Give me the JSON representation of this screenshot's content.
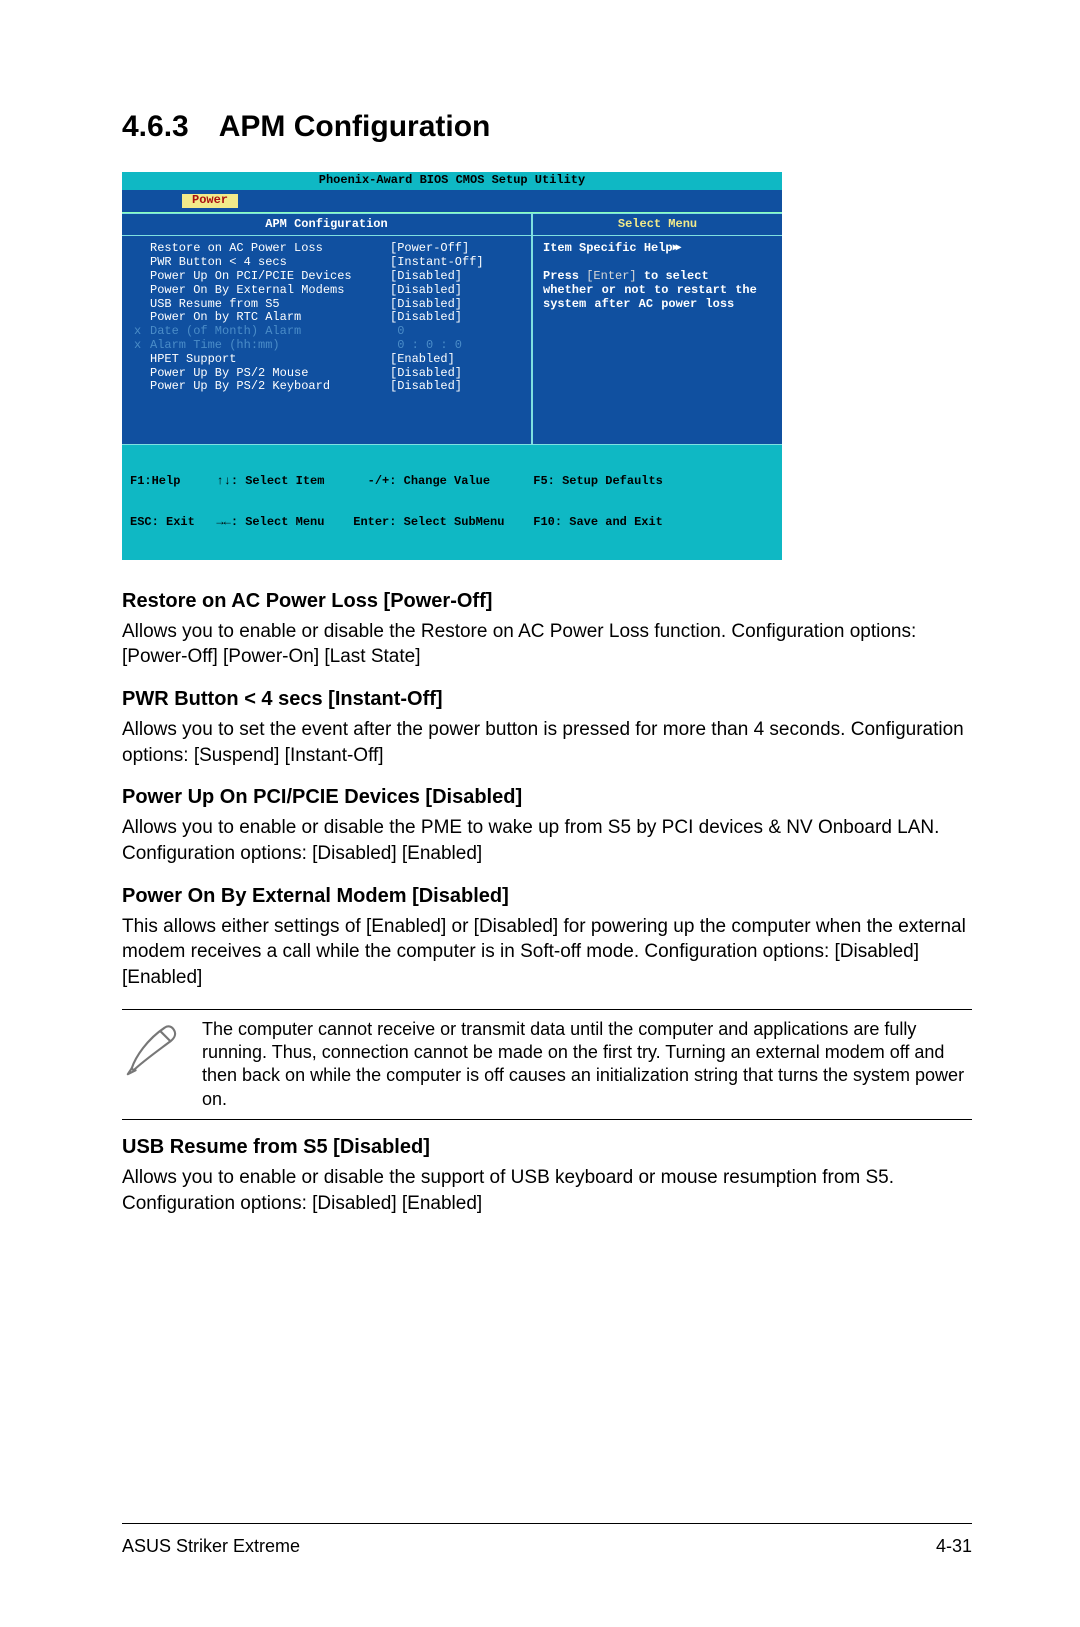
{
  "heading": {
    "num": "4.6.3",
    "title": "APM Configuration"
  },
  "bios": {
    "utility_title": "Phoenix-Award BIOS CMOS Setup Utility",
    "tab": "Power",
    "panel_title": "APM Configuration",
    "help_title": "Select Menu",
    "items": [
      {
        "label": "Restore on AC Power Loss",
        "value": "[Power-Off]",
        "dim": false,
        "x": ""
      },
      {
        "label": "PWR Button < 4 secs",
        "value": "[Instant-Off]",
        "dim": false,
        "x": ""
      },
      {
        "label": "Power Up On PCI/PCIE Devices",
        "value": "[Disabled]",
        "dim": false,
        "x": ""
      },
      {
        "label": "Power On By External Modems",
        "value": "[Disabled]",
        "dim": false,
        "x": ""
      },
      {
        "label": "USB Resume from S5",
        "value": "[Disabled]",
        "dim": false,
        "x": ""
      },
      {
        "label": "Power On by RTC Alarm",
        "value": "[Disabled]",
        "dim": false,
        "x": ""
      },
      {
        "label": "Date (of Month) Alarm",
        "value": " 0",
        "dim": true,
        "x": "x"
      },
      {
        "label": "Alarm Time (hh:mm)",
        "value": " 0 : 0 : 0",
        "dim": true,
        "x": "x"
      },
      {
        "label": "HPET Support",
        "value": "[Enabled]",
        "dim": false,
        "x": ""
      },
      {
        "label": "Power Up By PS/2 Mouse",
        "value": "[Disabled]",
        "dim": false,
        "x": ""
      },
      {
        "label": "Power Up By PS/2 Keyboard",
        "value": "[Disabled]",
        "dim": false,
        "x": ""
      }
    ],
    "help": {
      "heading": "Item Specific Help",
      "line1": "Press ",
      "enter": "[Enter]",
      "line1b": " to select",
      "line2": "whether or not to restart the system after AC power loss"
    },
    "footer_line1": "F1:Help     ↑↓: Select Item      -/+: Change Value      F5: Setup Defaults",
    "footer_line2": "ESC: Exit   →←: Select Menu    Enter: Select SubMenu    F10: Save and Exit"
  },
  "settings": [
    {
      "title": "Restore on AC Power Loss [Power-Off]",
      "body": "Allows you to enable or disable the Restore on AC Power Loss function. Configuration options: [Power-Off] [Power-On] [Last State]"
    },
    {
      "title": "PWR Button < 4 secs [Instant-Off]",
      "body": "Allows you to set the event after the power button is pressed for more than 4 seconds. Configuration options: [Suspend] [Instant-Off]"
    },
    {
      "title": "Power Up On PCI/PCIE Devices [Disabled]",
      "body": "Allows you to enable or disable the PME to wake up from S5 by PCI devices & NV Onboard LAN. Configuration options: [Disabled] [Enabled]"
    },
    {
      "title": "Power On By External Modem [Disabled]",
      "body": "This allows either settings of [Enabled] or [Disabled] for powering up the computer when the external modem receives a call while the computer is in Soft-off mode. Configuration options: [Disabled] [Enabled]"
    }
  ],
  "note": "The computer cannot receive or transmit data until the computer and applications are fully running. Thus, connection cannot be made on the first try. Turning an external modem off and then back on while the computer is off causes an initialization string that turns the system power on.",
  "settings2": [
    {
      "title": "USB Resume from S5 [Disabled]",
      "body": "Allows you to enable or disable the support of USB keyboard or mouse resumption from S5. Configuration options: [Disabled] [Enabled]"
    }
  ],
  "footer": {
    "left": "ASUS Striker Extreme",
    "right": "4-31"
  }
}
